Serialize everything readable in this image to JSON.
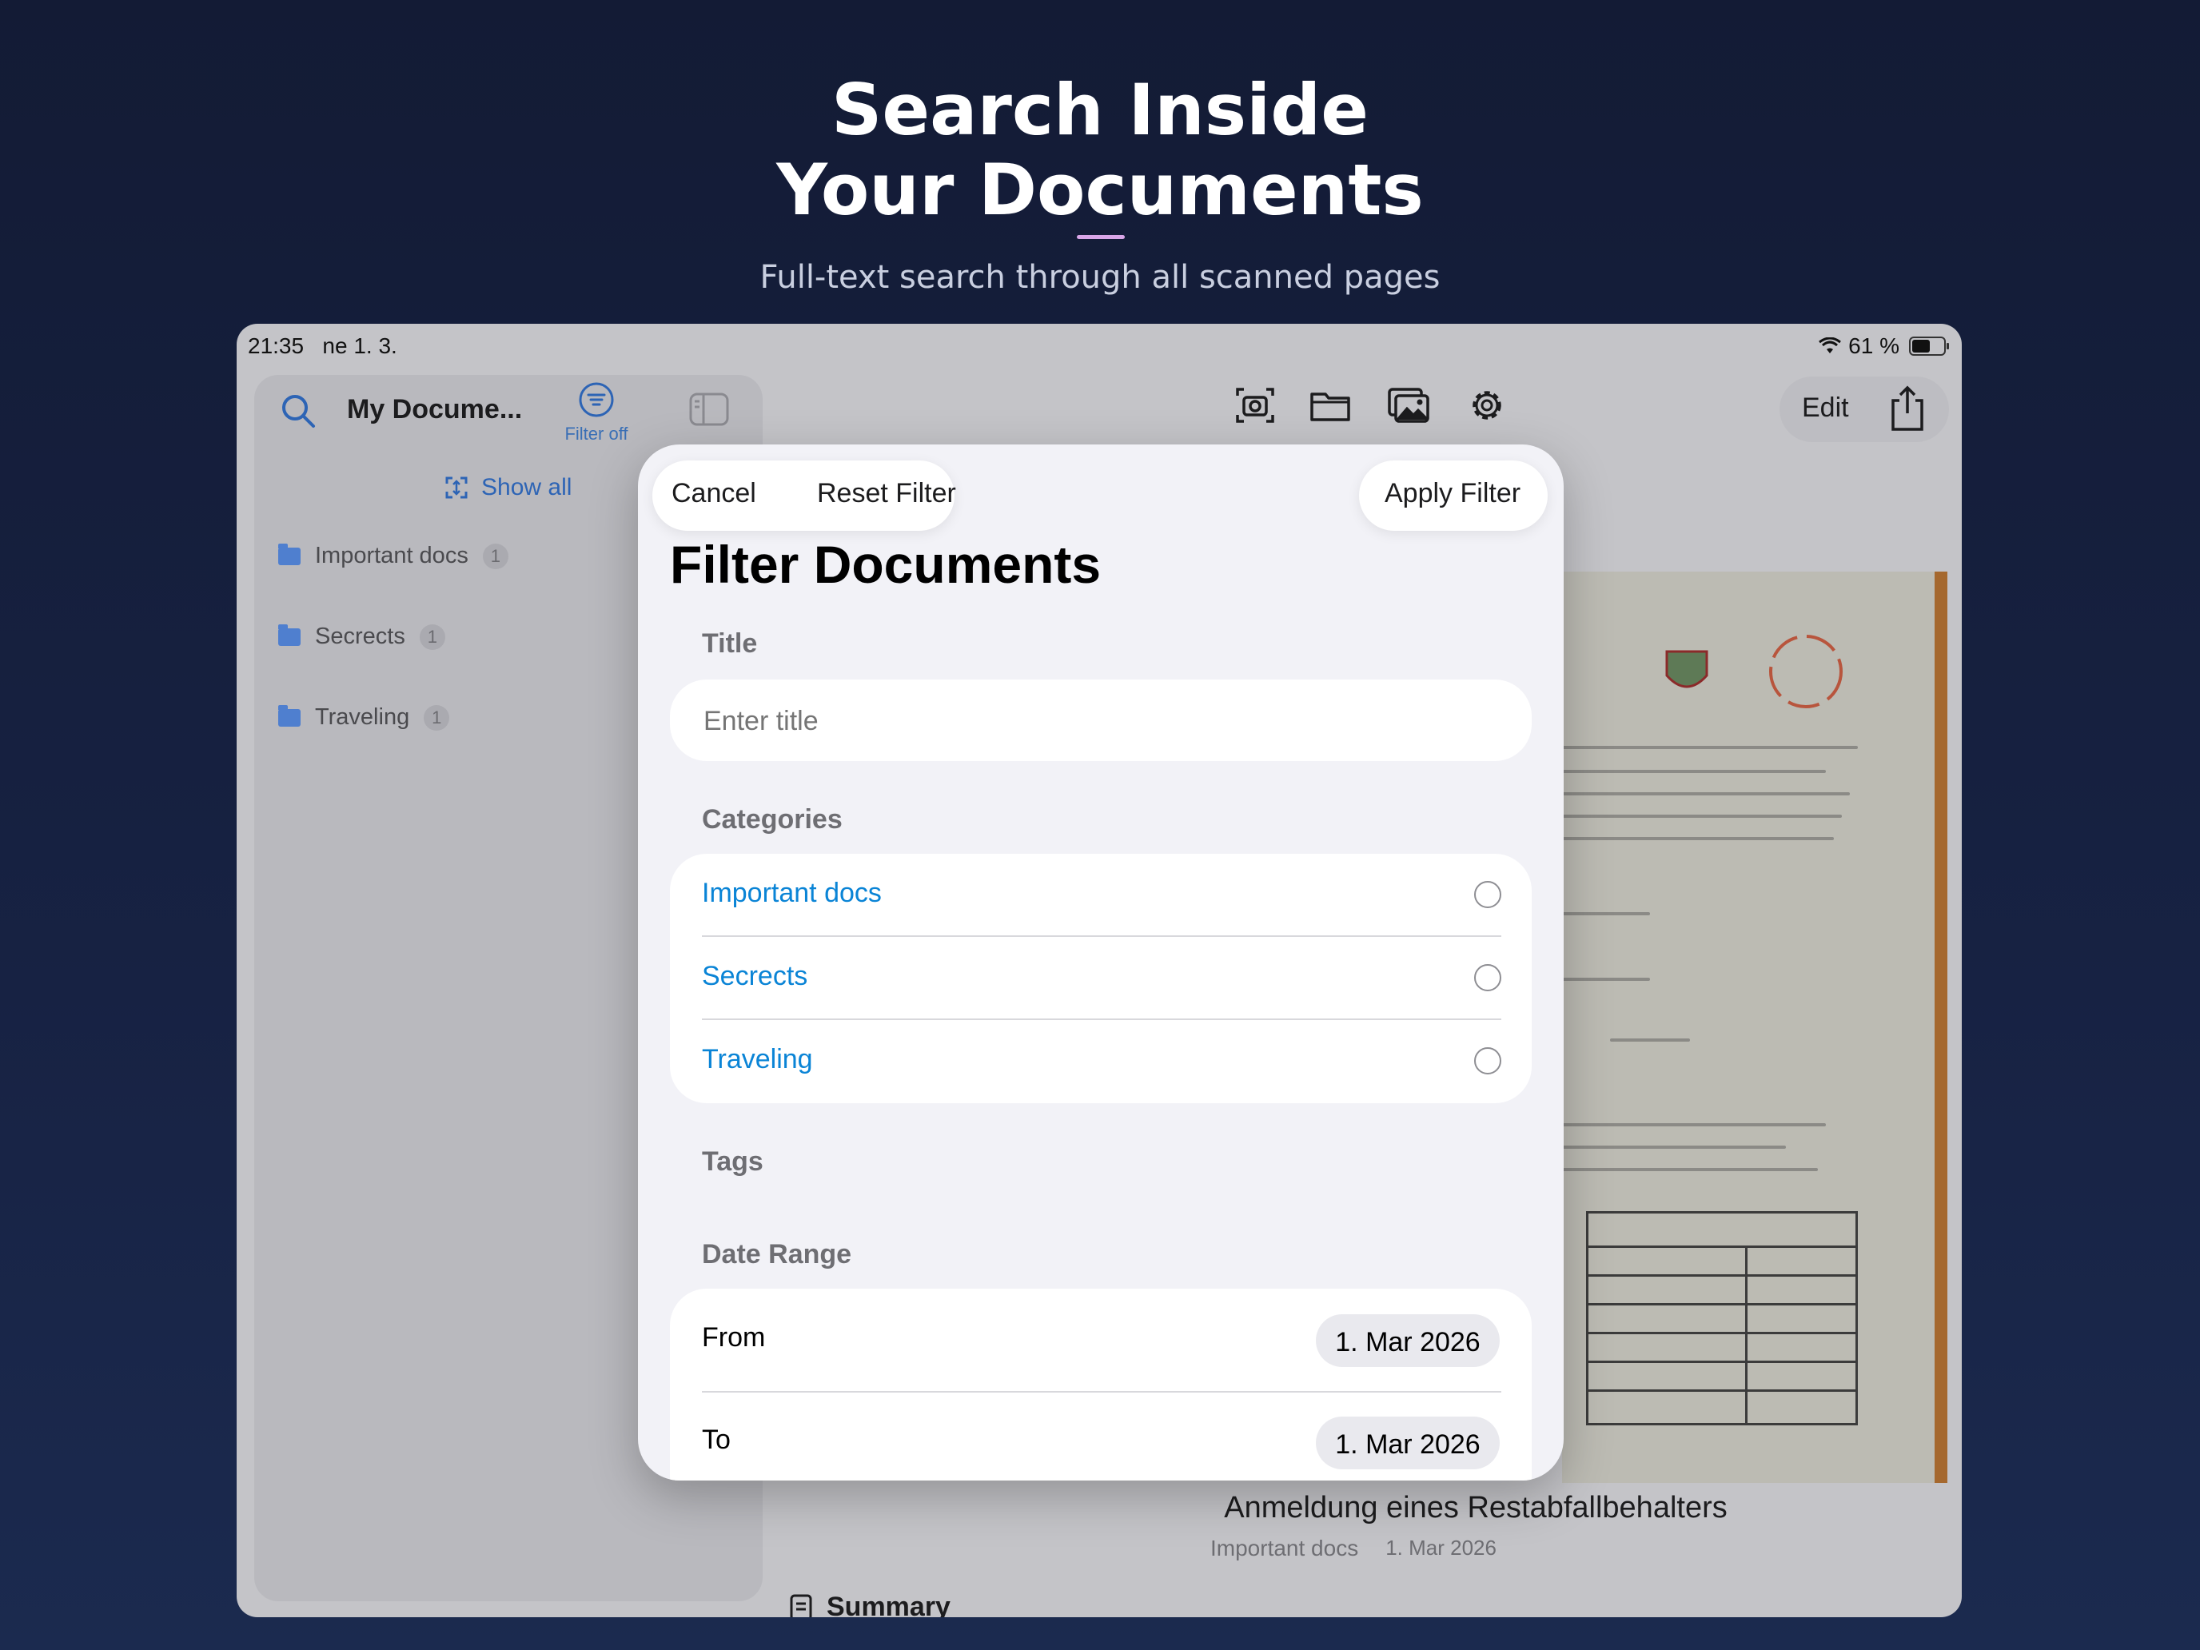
{
  "hero": {
    "title_line1": "Search Inside",
    "title_line2": "Your Documents",
    "subtitle": "Full-text search through all scanned pages"
  },
  "status_bar": {
    "time": "21:35",
    "date": "ne 1. 3.",
    "battery": "61 %"
  },
  "sidebar": {
    "title": "My Docume...",
    "filter_label": "Filter off",
    "show_all": "Show all",
    "folders": [
      {
        "name": "Important docs",
        "count": "1"
      },
      {
        "name": "Secrects",
        "count": "1"
      },
      {
        "name": "Traveling",
        "count": "1"
      }
    ]
  },
  "toolbar": {
    "edit_label": "Edit",
    "icons": [
      "camera-scan-icon",
      "folder-icon",
      "photo-library-icon",
      "gear-icon",
      "share-icon"
    ]
  },
  "document": {
    "title": "Anmeldung eines Restabfallbehalters",
    "category": "Important docs",
    "date": "1. Mar 2026",
    "summary_label": "Summary"
  },
  "filter_modal": {
    "cancel_label": "Cancel",
    "reset_label": "Reset Filter",
    "apply_label": "Apply Filter",
    "heading": "Filter Documents",
    "title_section": "Title",
    "title_placeholder": "Enter title",
    "categories_section": "Categories",
    "categories": [
      {
        "name": "Important docs",
        "selected": false
      },
      {
        "name": "Secrects",
        "selected": false
      },
      {
        "name": "Traveling",
        "selected": false
      }
    ],
    "tags_section": "Tags",
    "date_range_section": "Date Range",
    "from_label": "From",
    "from_value": "1. Mar 2026",
    "to_label": "To",
    "to_value": "1. Mar 2026"
  },
  "colors": {
    "background": "#131b35",
    "accent": "#d9a6e8",
    "link_blue": "#0a84d6",
    "modal_bg": "#f2f2f7"
  }
}
